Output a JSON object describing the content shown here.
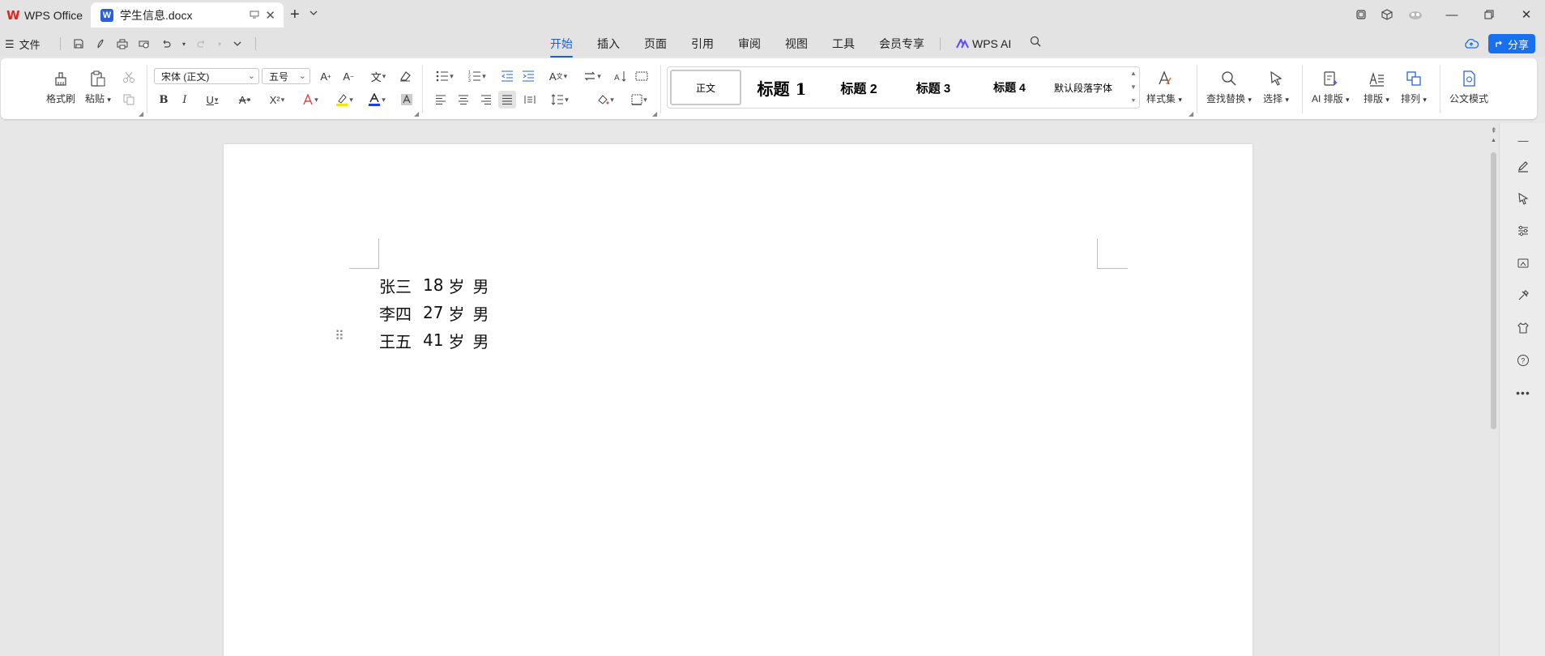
{
  "titlebar": {
    "app_tab_label": "WPS Office",
    "doc_tab_label": "学生信息.docx",
    "doc_icon_letter": "W"
  },
  "menubar": {
    "file_label": "文件",
    "tabs": [
      {
        "label": "开始",
        "active": true
      },
      {
        "label": "插入"
      },
      {
        "label": "页面"
      },
      {
        "label": "引用"
      },
      {
        "label": "审阅"
      },
      {
        "label": "视图"
      },
      {
        "label": "工具"
      },
      {
        "label": "会员专享"
      }
    ],
    "wps_ai_label": "WPS AI",
    "share_label": "分享"
  },
  "ribbon": {
    "format_painter_label": "格式刷",
    "paste_label": "粘贴",
    "font_name": "宋体 (正文)",
    "font_size": "五号",
    "styles": {
      "normal": "正文",
      "h1": "标题 1",
      "h2": "标题 2",
      "h3": "标题 3",
      "h4": "标题 4",
      "default_para": "默认段落字体"
    },
    "style_set_label": "样式集",
    "find_replace_label": "查找替换",
    "select_label": "选择",
    "ai_layout_label": "AI 排版",
    "layout_label": "排版",
    "arrange_label": "排列",
    "official_mode_label": "公文模式"
  },
  "document": {
    "lines": [
      {
        "name": "张三",
        "age": "18",
        "unit": "岁",
        "gender": "男"
      },
      {
        "name": "李四",
        "age": "27",
        "unit": "岁",
        "gender": "男"
      },
      {
        "name": "王五",
        "age": "41",
        "unit": "岁",
        "gender": "男"
      }
    ]
  },
  "colors": {
    "accent": "#1a5fe0",
    "share_button": "#1a6ff0",
    "wps_red": "#e2231a",
    "highlight_yellow": "#f5e600",
    "font_color_blue": "#1f3fe0"
  }
}
